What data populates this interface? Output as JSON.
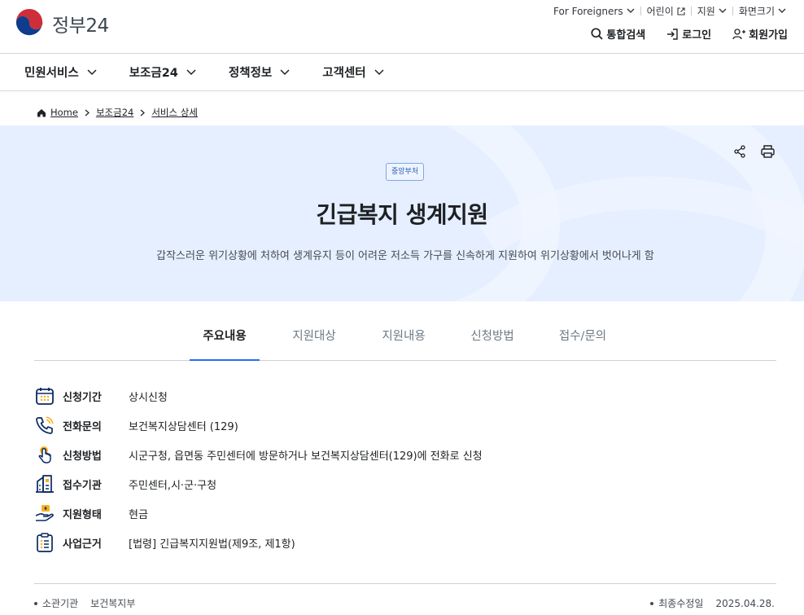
{
  "header": {
    "logo_text": "정부24",
    "util_links": [
      "For Foreigners",
      "어린이",
      "지원",
      "화면크기"
    ],
    "account": {
      "search": "통합검색",
      "login": "로그인",
      "join": "회원가입"
    }
  },
  "gnb": [
    "민원서비스",
    "보조금24",
    "정책정보",
    "고객센터"
  ],
  "breadcrumb": {
    "home": "Home",
    "level1": "보조금24",
    "level2": "서비스 상세"
  },
  "hero": {
    "badge": "중앙부처",
    "title": "긴급복지 생계지원",
    "description": "갑작스러운 위기상황에 처하여 생계유지 등이 어려운 저소득 가구를 신속하게 지원하여 위기상황에서 벗어나게 함"
  },
  "tabs": [
    "주요내용",
    "지원대상",
    "지원내용",
    "신청방법",
    "접수/문의"
  ],
  "info": [
    {
      "icon": "calendar-icon",
      "label": "신청기간",
      "value": "상시신청"
    },
    {
      "icon": "phone-icon",
      "label": "전화문의",
      "value": "보건복지상담센터 (129)"
    },
    {
      "icon": "hand-tap-icon",
      "label": "신청방법",
      "value": "시군구청, 읍면동 주민센터에 방문하거나 보건복지상담센터(129)에 전화로 신청"
    },
    {
      "icon": "building-icon",
      "label": "접수기관",
      "value": "주민센터,시·군·구청"
    },
    {
      "icon": "hand-coin-icon",
      "label": "지원형태",
      "value": "현금"
    },
    {
      "icon": "document-list-icon",
      "label": "사업근거",
      "value": "[법령] 긴급복지지원법(제9조, 제1항)"
    }
  ],
  "meta": {
    "org_label": "소관기관",
    "org_value": "보건복지부",
    "updated_label": "최종수정일",
    "updated_value": "2025.04.28."
  },
  "colors": {
    "accent": "#256ef4",
    "hero_bg": "#e6efff",
    "icon_navy": "#0b2a63",
    "icon_gold": "#f6b01e"
  }
}
